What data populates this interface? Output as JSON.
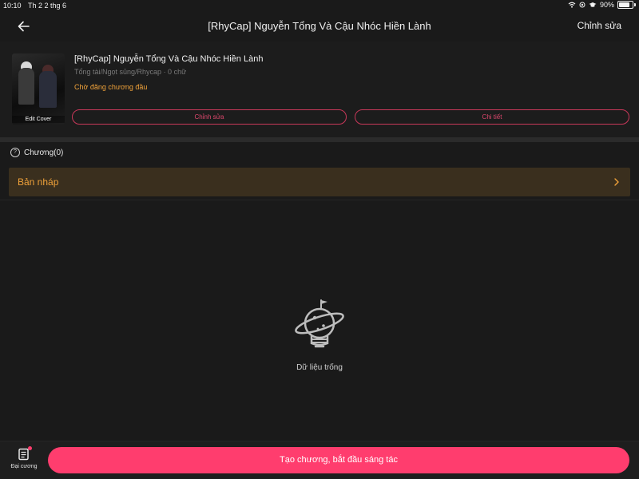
{
  "status_bar": {
    "time": "10:10",
    "date": "Th 2 2 thg 6",
    "battery": "90%",
    "battery_level": 0.9
  },
  "nav": {
    "title": "[RhyCap] Nguyễn Tổng Và Cậu Nhóc Hiền Lành",
    "edit_label": "Chỉnh sửa"
  },
  "story": {
    "title": "[RhyCap] Nguyễn Tổng Và Cậu Nhóc Hiền Lành",
    "meta": "Tổng tài/Ngọt sủng/Rhycap · 0 chữ",
    "status": "Chờ đăng chương đầu",
    "cover_label": "Edit Cover",
    "edit_button": "Chỉnh sửa",
    "detail_button": "Chi tiết"
  },
  "chapters": {
    "label": "Chương(0)",
    "drafts_label": "Bản nháp"
  },
  "empty_state": {
    "text": "Dữ liệu trống",
    "icon": "planet-lightbulb-icon"
  },
  "bottom": {
    "outline_label": "Đại cương",
    "create_button": "Tạo chương, bắt đầu sáng tác"
  },
  "colors": {
    "accent": "#ff3d6e",
    "warning": "#f0a23a",
    "background": "#1a1a1a"
  }
}
